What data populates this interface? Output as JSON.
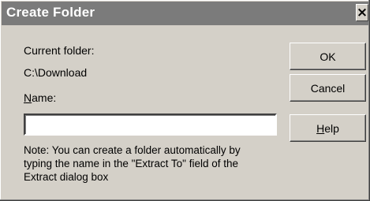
{
  "window": {
    "title": "Create Folder",
    "close_glyph": "×",
    "close_icon": "close-icon"
  },
  "form": {
    "current_folder_label": "Current folder:",
    "current_folder_value": "C:\\Download",
    "name_label_mnemonic": "N",
    "name_label_rest": "ame:",
    "name_value": "",
    "note": "Note: You can create a folder automatically by typing the name in the \"Extract To\" field of the Extract dialog box"
  },
  "buttons": {
    "ok_label": "OK",
    "cancel_label": "Cancel",
    "help_mnemonic": "H",
    "help_rest": "elp"
  },
  "colors": {
    "dialog_face": "#d4d0c8",
    "titlebar_inactive": "#7b7b7b",
    "title_text": "#ffffff"
  }
}
